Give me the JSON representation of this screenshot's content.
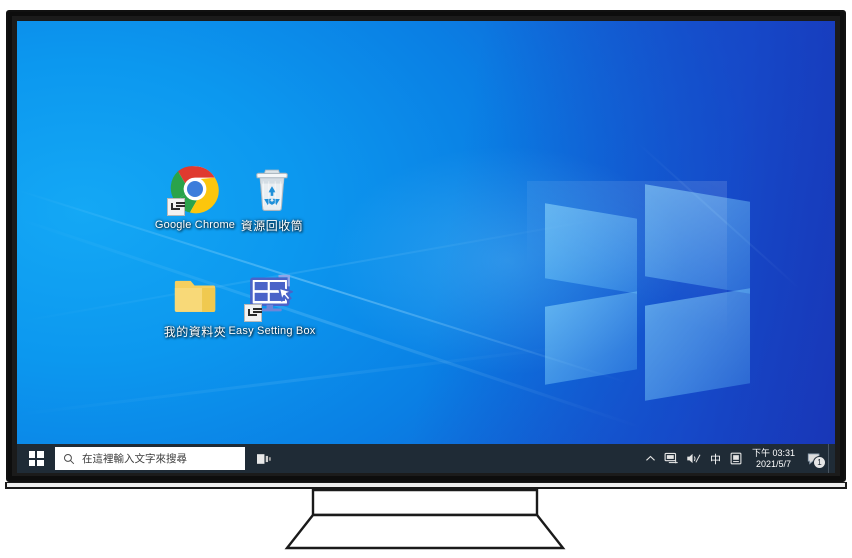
{
  "device": {
    "type": "desktop-monitor",
    "bezel_color": "#111111",
    "screen_bg": "#0a84d8"
  },
  "desktop": {
    "wallpaper": {
      "name": "windows-10-hero",
      "color_left": "#0c9cf0",
      "color_right": "#1b46c4",
      "logo": "windows-logo"
    },
    "icons": [
      {
        "id": "google-chrome",
        "label": "Google Chrome",
        "icon": "chrome-icon",
        "shortcut": true,
        "cjk": false
      },
      {
        "id": "recycle-bin",
        "label": "資源回收筒",
        "icon": "recycle-bin-icon",
        "shortcut": false,
        "cjk": true
      },
      {
        "id": "my-folder",
        "label": "我的資料夾",
        "icon": "folder-icon",
        "shortcut": false,
        "cjk": true
      },
      {
        "id": "easy-setting-box",
        "label": "Easy Setting Box",
        "icon": "easy-setting-box-icon",
        "shortcut": true,
        "cjk": false
      }
    ]
  },
  "taskbar": {
    "bg_color": "#1f2b36",
    "start": {
      "label": "開始",
      "icon": "windows-start-icon"
    },
    "search": {
      "placeholder": "在這裡輸入文字來搜尋",
      "value": "",
      "icon": "search-icon"
    },
    "task_view": {
      "label": "工作檢視",
      "icon": "task-view-icon"
    },
    "tray": {
      "overflow": {
        "label": "顯示隱藏的圖示",
        "icon": "chevron-up-icon"
      },
      "items": [
        {
          "id": "network",
          "label": "網路",
          "icon": "network-monitor-icon"
        },
        {
          "id": "volume",
          "label": "音量",
          "icon": "speaker-muted-icon"
        },
        {
          "id": "ime",
          "label": "中",
          "icon": "ime-chinese-icon",
          "text": "中"
        },
        {
          "id": "safely-remove",
          "label": "安全地移除硬體",
          "icon": "device-icon"
        }
      ],
      "clock": {
        "time": "下午 03:31",
        "date": "2021/5/7"
      },
      "notifications": {
        "label": "控制中心",
        "icon": "action-center-icon",
        "badge": "1"
      },
      "show_desktop": {
        "label": "顯示桌面"
      }
    }
  }
}
